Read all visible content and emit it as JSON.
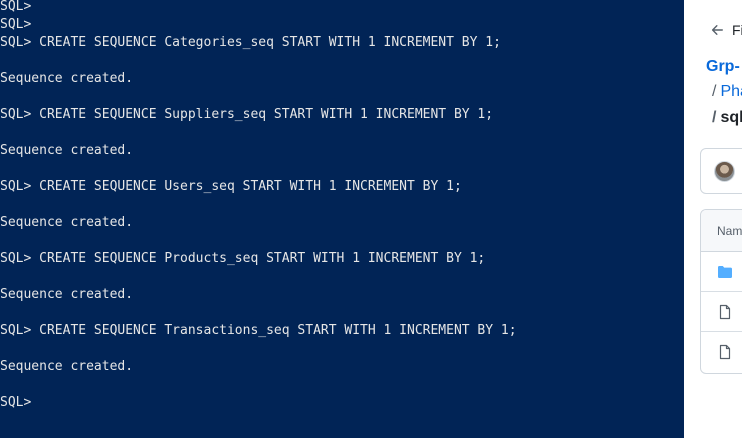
{
  "terminal": {
    "background": "#012456",
    "lines": [
      "SQL>",
      "SQL>",
      "SQL> CREATE SEQUENCE Categories_seq START WITH 1 INCREMENT BY 1;",
      "",
      "Sequence created.",
      "",
      "SQL> CREATE SEQUENCE Suppliers_seq START WITH 1 INCREMENT BY 1;",
      "",
      "Sequence created.",
      "",
      "SQL> CREATE SEQUENCE Users_seq START WITH 1 INCREMENT BY 1;",
      "",
      "Sequence created.",
      "",
      "SQL> CREATE SEQUENCE Products_seq START WITH 1 INCREMENT BY 1;",
      "",
      "Sequence created.",
      "",
      "SQL> CREATE SEQUENCE Transactions_seq START WITH 1 INCREMENT BY 1;",
      "",
      "Sequence created.",
      "",
      "SQL>"
    ]
  },
  "sidebar": {
    "back_label": "Fi",
    "back_icon": "arrow-left-icon",
    "breadcrumb": {
      "repo": "Grp-",
      "folder_sep": "/",
      "folder": "Pha",
      "current_sep": "/",
      "current": "sql"
    },
    "file_table": {
      "header": "Nam",
      "rows": [
        {
          "icon": "folder-icon"
        },
        {
          "icon": "file-icon"
        },
        {
          "icon": "file-icon"
        }
      ]
    },
    "colors": {
      "link": "#0969da",
      "folder": "#54aeff",
      "border": "#d0d7de"
    }
  }
}
